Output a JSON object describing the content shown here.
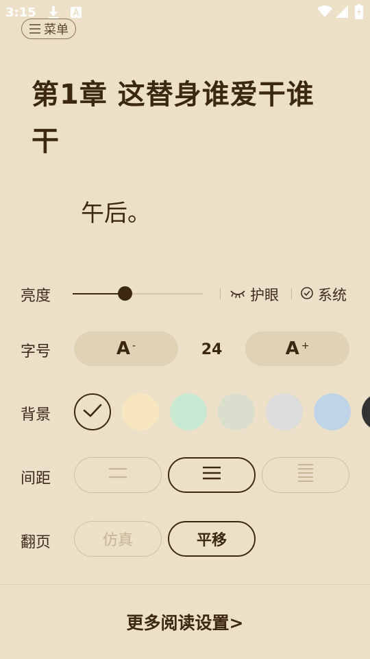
{
  "status_bar": {
    "time": "3:15",
    "icons": [
      "download-icon",
      "app-notification-icon",
      "wifi-icon",
      "signal-icon",
      "battery-charging-icon"
    ]
  },
  "reader": {
    "menu_label": "菜单",
    "chapter_title": "第1章 这替身谁爱干谁干",
    "body_text": "午后。"
  },
  "settings": {
    "brightness": {
      "label": "亮度",
      "level": 0.4,
      "eye_protect_label": "护眼",
      "system_label": "系统"
    },
    "font_size": {
      "label": "字号",
      "decrease_label": "A",
      "decrease_suffix": "-",
      "value": "24",
      "increase_label": "A",
      "increase_suffix": "+"
    },
    "background": {
      "label": "背景",
      "swatches": [
        {
          "name": "parchment",
          "color": "#ede0c9",
          "selected": true
        },
        {
          "name": "cream",
          "color": "#f7e6c0",
          "selected": false
        },
        {
          "name": "mint",
          "color": "#c8e8d2",
          "selected": false
        },
        {
          "name": "sage",
          "color": "#dadfcd",
          "selected": false
        },
        {
          "name": "grey",
          "color": "#dcdcdc",
          "selected": false
        },
        {
          "name": "blue",
          "color": "#c0d4e8",
          "selected": false
        },
        {
          "name": "dark",
          "color": "#333333",
          "selected": false
        }
      ]
    },
    "spacing": {
      "label": "间距",
      "options": [
        "wide",
        "medium",
        "narrow"
      ],
      "selected": "medium"
    },
    "page_turn": {
      "label": "翻页",
      "options": [
        "仿真",
        "平移"
      ],
      "selected": "平移"
    },
    "more_label": "更多阅读设置>"
  },
  "colors": {
    "accent": "#3b2712",
    "panel_bg": "#ede0c9",
    "pill_bg": "#e0d2b5"
  }
}
